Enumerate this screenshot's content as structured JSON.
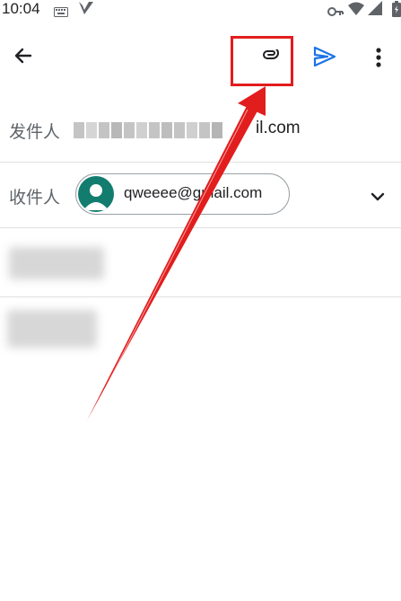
{
  "status_bar": {
    "time": "10:04",
    "icons": [
      "keyboard-icon",
      "app-notification-icon",
      "vpn-key-icon",
      "wifi-icon",
      "signal-icon",
      "battery-icon"
    ]
  },
  "app_bar": {
    "back_icon": "arrow-left-icon",
    "attach_icon": "paperclip-icon",
    "send_icon": "send-icon",
    "more_icon": "more-vert-icon",
    "accent_color": "#1a73e8"
  },
  "from": {
    "label": "发件人",
    "email_suffix": "il.com"
  },
  "to": {
    "label": "收件人",
    "chip_email": "qweeee@gmail.com",
    "avatar_color": "#127c6f",
    "expand_icon": "chevron-down-icon"
  },
  "annotation": {
    "color": "#e21d1d"
  }
}
